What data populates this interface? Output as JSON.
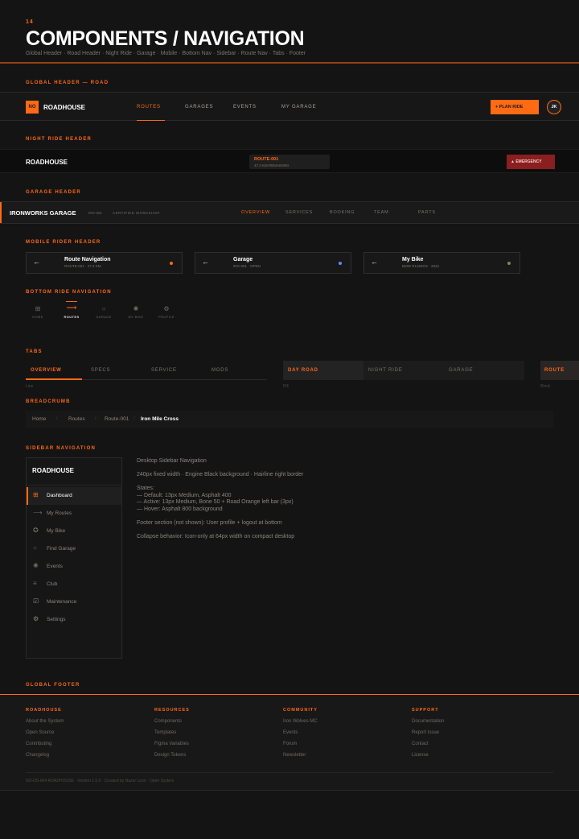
{
  "page": {
    "number": "14",
    "title": "COMPONENTS / NAVIGATION",
    "subtitle": "Global Header · Road Header · Night Ride · Garage · Mobile · Bottom Nav · Sidebar · Route Nav · Tabs · Footer"
  },
  "global_header": {
    "section": "GLOBAL HEADER — ROAD",
    "logo_badge": "NO",
    "logo_text": "ROADHOUSE",
    "nav": [
      "ROUTES",
      "GARAGES",
      "EVENTS",
      "MY GARAGE"
    ],
    "active_index": 0,
    "cta": "+ PLAN RIDE",
    "avatar": "JK"
  },
  "night_header": {
    "section": "NIGHT RIDE HEADER",
    "logo_text": "ROADHOUSE",
    "route_title": "ROUTE-001",
    "route_sub": "47.3 KM REMAINING",
    "emergency": "▲ EMERGENCY"
  },
  "garage_header": {
    "section": "GARAGE HEADER",
    "name": "IRONWORKS GARAGE",
    "code": "IRG-001",
    "tag": "CERTIFIED WORKSHOP",
    "nav": [
      "OVERVIEW",
      "SERVICES",
      "BOOKING",
      "TEAM",
      "PARTS"
    ]
  },
  "mobile_header": {
    "section": "MOBILE RIDER HEADER",
    "cards": [
      {
        "title": "Route Navigation",
        "sub": "ROUTE-001 · 47.3 KM",
        "dot": "#ff6a13"
      },
      {
        "title": "Garage",
        "sub": "IRG-001 · OPEN",
        "dot": "#5b8cff"
      },
      {
        "title": "My Bike",
        "sub": "BMW R1250GS · 2022",
        "dot": "#7a8c4a"
      }
    ]
  },
  "bottom_nav": {
    "section": "BOTTOM RIDE NAVIGATION",
    "items": [
      "HOME",
      "ROUTES",
      "GARAGE",
      "MY BIKE",
      "PROFILE"
    ],
    "active_index": 1
  },
  "tabs": {
    "section": "TABS",
    "group1": [
      "OVERVIEW",
      "SPECS",
      "SERVICE",
      "MODS"
    ],
    "group1_caption": "Line",
    "group2": [
      "DAY ROAD",
      "NIGHT RIDE",
      "GARAGE"
    ],
    "group2_caption": "Pill",
    "group3": [
      "ROUTE"
    ],
    "group3_caption": "Block"
  },
  "breadcrumb": {
    "section": "BREADCRUMB",
    "items": [
      "Home",
      "Routes",
      "Route-001",
      "Iron Mile Cross"
    ]
  },
  "sidebar": {
    "section": "SIDEBAR NAVIGATION",
    "logo": "ROADHOUSE",
    "items": [
      "Dashboard",
      "My Routes",
      "My Bike",
      "Find Garage",
      "Events",
      "Club",
      "Maintenance",
      "Settings"
    ],
    "active_index": 0,
    "notes": {
      "title": "Desktop Sidebar Navigation",
      "line1": "240px fixed width · Engine Black background · Hairline right border",
      "states_title": "States:",
      "state1": "— Default: 13px Medium, Asphalt 400",
      "state2": "— Active: 13px Medium, Bone 50 + Road Orange left bar (3px)",
      "state3": "— Hover: Asphalt 800 background",
      "footer": "Footer section (not shown): User profile + logout at bottom",
      "collapse": "Collapse behavior: Icon-only at 64px width on compact desktop"
    }
  },
  "footer": {
    "section": "GLOBAL FOOTER",
    "columns": [
      {
        "title": "ROADHOUSE",
        "links": [
          "About the System",
          "Open Source",
          "Contributing",
          "Changelog"
        ]
      },
      {
        "title": "RESOURCES",
        "links": [
          "Components",
          "Templates",
          "Figma Variables",
          "Design Tokens"
        ]
      },
      {
        "title": "COMMUNITY",
        "links": [
          "Iron Wolves MC",
          "Events",
          "Forum",
          "Newsletter"
        ]
      },
      {
        "title": "SUPPORT",
        "links": [
          "Documentation",
          "Report Issue",
          "Contact",
          "License"
        ]
      }
    ],
    "copyright": "NO-DS-004 ROADHOUSE · Version 1.0.0 · Created by Nazar Leon · Open System"
  },
  "colors": {
    "accent": "#ff6a13",
    "danger": "#8a1f1f",
    "bg": "#141414",
    "panel": "#1b1b1b"
  }
}
